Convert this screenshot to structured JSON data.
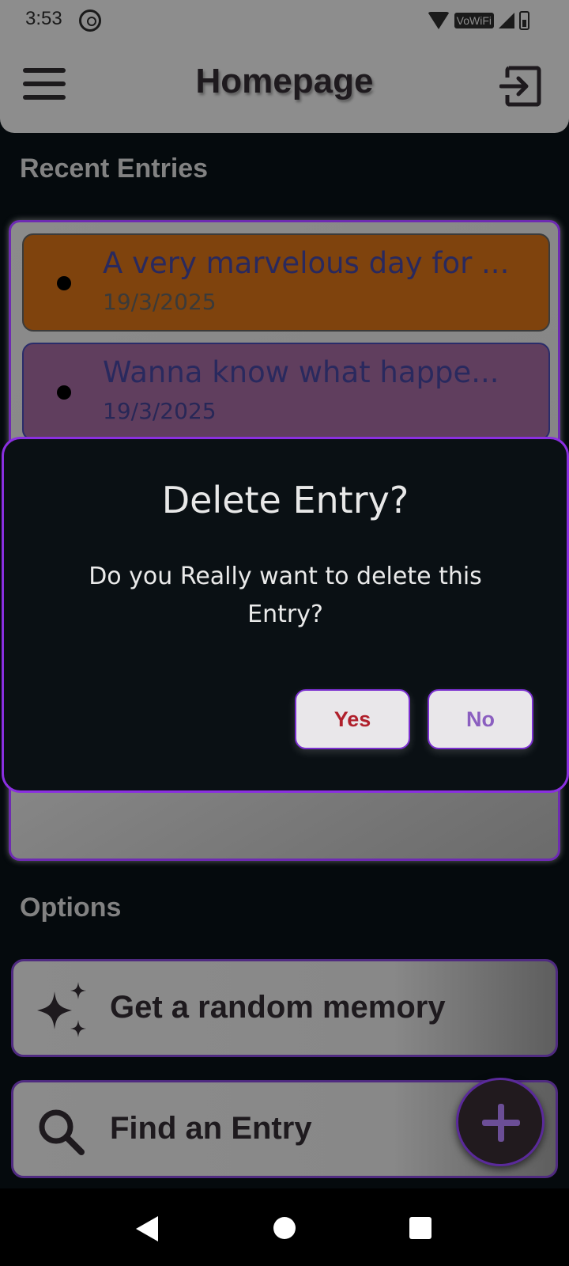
{
  "status_bar": {
    "time": "3:53",
    "vowifi": "VoWiFi"
  },
  "app_bar": {
    "title": "Homepage"
  },
  "recent_entries": {
    "heading": "Recent Entries",
    "items": [
      {
        "title": "A very marvelous day for ...",
        "date": "19/3/2025",
        "color": "#7f430d"
      },
      {
        "title": "Wanna know what happe...",
        "date": "19/3/2025",
        "color": "#603e5e"
      }
    ]
  },
  "options": {
    "heading": "Options",
    "random_memory_label": "Get a random memory",
    "find_entry_label": "Find an Entry"
  },
  "dialog": {
    "title": "Delete Entry?",
    "message": "Do you Really want to delete this Entry?",
    "yes_label": "Yes",
    "no_label": "No"
  },
  "colors": {
    "accent": "#8a2fe0",
    "yes": "#b0202c",
    "no": "#8b5fc0"
  }
}
